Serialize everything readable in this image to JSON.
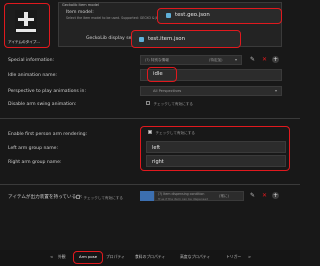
{
  "item_type": {
    "label": "アイテムのタイプ..."
  },
  "section": {
    "title": "Geckolib item model"
  },
  "item_model": {
    "label": "Item model:",
    "hint": "Select the item model to be used. Supported: GECKO & JE",
    "value": "test.geo.json"
  },
  "display_settings": {
    "label": "GeckoLib display settings:",
    "value": "test.item.json"
  },
  "special_info": {
    "label": "Special information:",
    "value": "(?) 特別な情報",
    "select": "(特定加)"
  },
  "idle_animation": {
    "label": "Idle animation name:",
    "value": "idle"
  },
  "perspective": {
    "label": "Perspective to play animations in:",
    "value": "All Perspectives"
  },
  "disable_swing": {
    "label": "Disable arm swing animation:",
    "checkbox_label": "チェックして有効にする"
  },
  "first_person": {
    "label": "Enable first person arm rendering:",
    "checkbox_label": "チェックして有効にする"
  },
  "left_arm": {
    "label": "Left arm group name:",
    "value": "left"
  },
  "right_arm": {
    "label": "Right arm group name:",
    "value": "right"
  },
  "dispense": {
    "label": "アイテムが出力装置を持っているか:",
    "checkbox_label": "チェックして有効にする",
    "condition": "(?) Item dispensing condition",
    "condition_sub": "True if the item can be dispensed",
    "select": "(常に)"
  },
  "tabs": [
    "外観",
    "Arm pose",
    "プロパティ",
    "食料のプロパティ",
    "高度なプロパティ",
    "トリガー"
  ],
  "tab_prefix": "<",
  "tab_suffix": ">",
  "colors": {
    "highlight": "#e0191e",
    "background": "#181818",
    "field": "#2c2c2c"
  }
}
